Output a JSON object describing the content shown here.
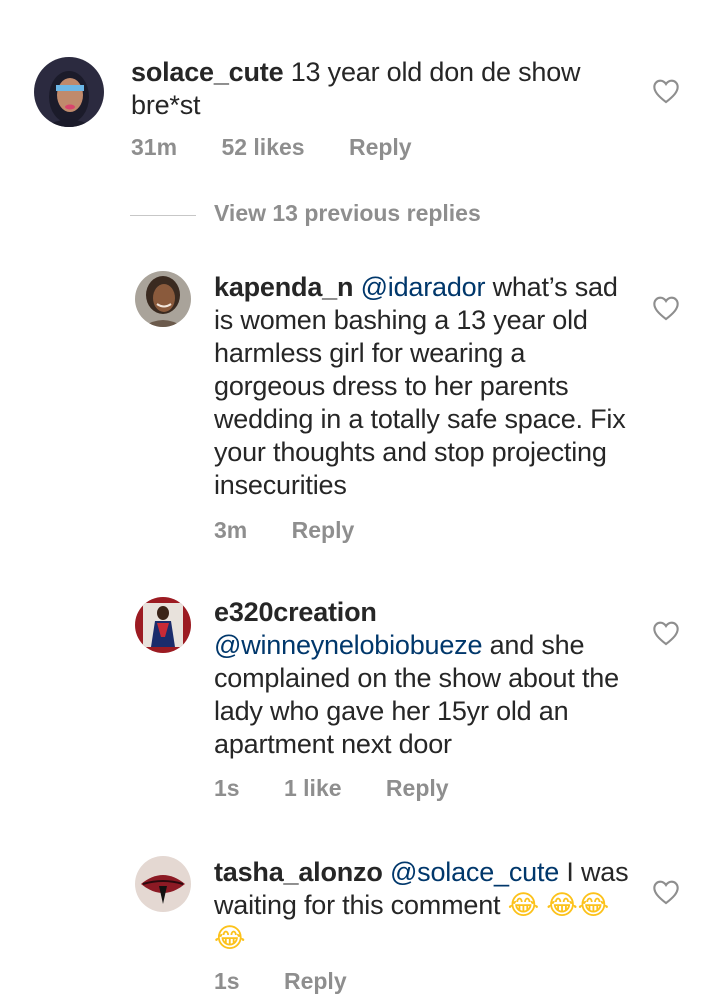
{
  "comments": [
    {
      "username": "solace_cute",
      "mention": "",
      "text": "13 year old don de show bre*st",
      "time": "31m",
      "likes": "52 likes",
      "reply": "Reply",
      "avatar_icon": "profile-photo"
    },
    {
      "username": "kapenda_n",
      "mention": "@idarador",
      "text": "what’s sad is women bashing a 13 year old harmless girl for wearing a gorgeous dress to her parents wedding in a totally safe space. Fix your thoughts and stop projecting insecurities",
      "time": "3m",
      "likes": "",
      "reply": "Reply",
      "avatar_icon": "profile-photo"
    },
    {
      "username": "e320creation",
      "mention": "@winneynelobiobueze",
      "text": "and she complained on the show about the lady who gave her 15yr old an apartment next door",
      "time": "1s",
      "likes": "1 like",
      "reply": "Reply",
      "avatar_icon": "profile-photo"
    },
    {
      "username": "tasha_alonzo",
      "mention": "@solace_cute",
      "text": "I was waiting for this comment",
      "emoji": "😂 😂😂😂",
      "time": "1s",
      "likes": "",
      "reply": "Reply",
      "avatar_icon": "profile-photo"
    }
  ],
  "replies_toggle": "View 13 previous replies",
  "icons": {
    "like": "heart-outline-icon",
    "emoji": "face-with-tears-of-joy"
  },
  "colors": {
    "text": "#262626",
    "meta": "#8e8e8e",
    "mention": "#00376b",
    "emoji_face": "#fcc21b"
  }
}
